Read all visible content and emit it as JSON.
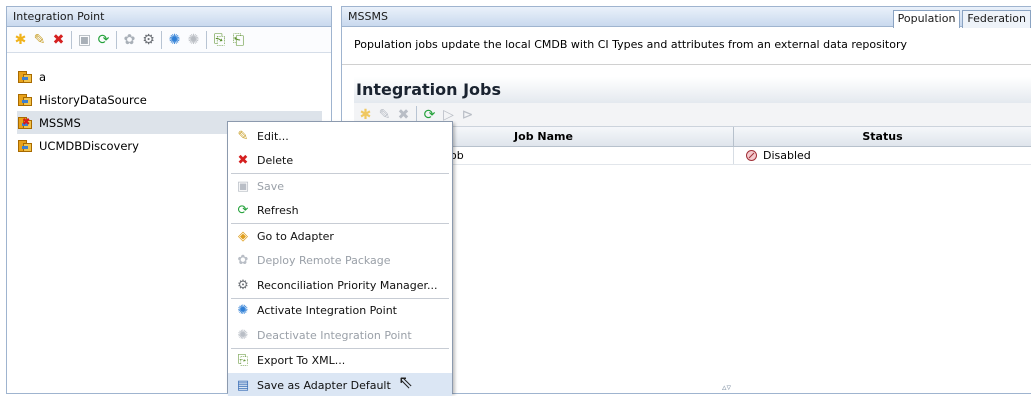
{
  "left_panel": {
    "title": "Integration Point",
    "toolbar": [
      {
        "icon": "new-icon",
        "glyph": "✱",
        "color": "#f0b21a",
        "enabled": true
      },
      {
        "icon": "edit-icon",
        "glyph": "✎",
        "color": "#c9a02b",
        "enabled": true
      },
      {
        "icon": "delete-icon",
        "glyph": "✖",
        "color": "#d52020",
        "enabled": true
      },
      {
        "icon": "save-icon",
        "glyph": "▣",
        "color": "#a9b0b8",
        "enabled": false
      },
      {
        "icon": "refresh-icon",
        "glyph": "⟳",
        "color": "#23a13a",
        "enabled": true
      },
      {
        "icon": "deploy-icon",
        "glyph": "✿",
        "color": "#a9b0b8",
        "enabled": false
      },
      {
        "icon": "reconciliation-icon",
        "glyph": "⚙",
        "color": "#6b6f75",
        "enabled": true
      },
      {
        "icon": "activate-icon",
        "glyph": "✺",
        "color": "#2f7fd6",
        "enabled": true
      },
      {
        "icon": "deactivate-icon",
        "glyph": "✺",
        "color": "#b8bcc2",
        "enabled": false
      },
      {
        "icon": "export-xml-icon",
        "glyph": "⎘",
        "color": "#5a8f2b",
        "enabled": true
      },
      {
        "icon": "import-xml-icon",
        "glyph": "⎗",
        "color": "#5a8f2b",
        "enabled": true
      }
    ],
    "tree_items": [
      {
        "label": "a",
        "selected": false,
        "error": false
      },
      {
        "label": "HistoryDataSource",
        "selected": false,
        "error": false
      },
      {
        "label": "MSSMS",
        "selected": true,
        "error": true
      },
      {
        "label": "UCMDBDiscovery",
        "selected": false,
        "error": false
      }
    ]
  },
  "right_panel": {
    "title": "MSSMS",
    "tabs": [
      "Population",
      "Federation"
    ],
    "active_tab": "Population",
    "description": "Population jobs update the local CMDB with CI Types and attributes from an external data repository",
    "jobs_title": "Integration Jobs",
    "jobs_toolbar": [
      {
        "icon": "new-job-icon",
        "glyph": "✱"
      },
      {
        "icon": "edit-job-icon",
        "glyph": "✎"
      },
      {
        "icon": "delete-job-icon",
        "glyph": "✖"
      },
      {
        "icon": "refresh-jobs-icon",
        "glyph": "⟳"
      },
      {
        "icon": "run-icon",
        "glyph": "▷"
      },
      {
        "icon": "run-all-icon",
        "glyph": "⊳"
      }
    ],
    "columns": {
      "job_name": "Job Name",
      "status": "Status"
    },
    "rows": [
      {
        "job_name": "ob",
        "status": "Disabled"
      }
    ],
    "splitter_glyph": "▵▿"
  },
  "context_menu": {
    "groups": [
      [
        {
          "label": "Edit...",
          "icon": "pencil-icon",
          "glyph": "✎",
          "color": "#c9a02b",
          "disabled": false
        },
        {
          "label": "Delete",
          "icon": "delete-icon",
          "glyph": "✖",
          "color": "#d52020",
          "disabled": false
        }
      ],
      [
        {
          "label": "Save",
          "icon": "save-icon",
          "glyph": "▣",
          "color": "#b9bec6",
          "disabled": true
        },
        {
          "label": "Refresh",
          "icon": "refresh-icon",
          "glyph": "⟳",
          "color": "#23a13a",
          "disabled": false
        }
      ],
      [
        {
          "label": "Go to Adapter",
          "icon": "adapter-icon",
          "glyph": "◈",
          "color": "#e0a020",
          "disabled": false
        },
        {
          "label": "Deploy Remote Package",
          "icon": "deploy-package-icon",
          "glyph": "✿",
          "color": "#b9bec6",
          "disabled": true
        },
        {
          "label": "Reconciliation Priority Manager...",
          "icon": "reconciliation-icon",
          "glyph": "⚙",
          "color": "#6b6f75",
          "disabled": false
        }
      ],
      [
        {
          "label": "Activate Integration Point",
          "icon": "activate-icon",
          "glyph": "✺",
          "color": "#2f7fd6",
          "disabled": false
        },
        {
          "label": "Deactivate Integration Point",
          "icon": "deactivate-icon",
          "glyph": "✺",
          "color": "#b9bec6",
          "disabled": true
        }
      ],
      [
        {
          "label": "Export To XML...",
          "icon": "export-xml-icon",
          "glyph": "⎘",
          "color": "#5a8f2b",
          "disabled": false
        },
        {
          "label": "Save as Adapter Default",
          "icon": "save-adapter-default-icon",
          "glyph": "▤",
          "color": "#3b6fb6",
          "disabled": false,
          "hover": true
        }
      ]
    ]
  }
}
